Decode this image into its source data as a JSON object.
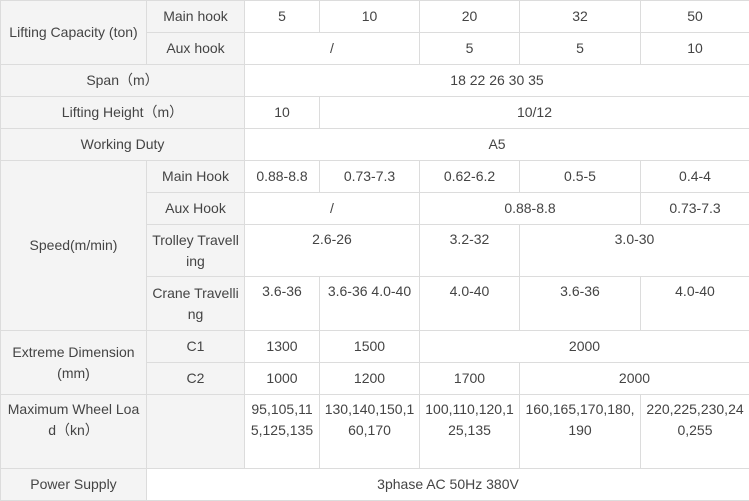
{
  "lifting_capacity": {
    "label": "Lifting Capacity (ton)",
    "main_hook": {
      "label": "Main hook",
      "values": [
        "5",
        "10",
        "20",
        "32",
        "50"
      ]
    },
    "aux_hook": {
      "label": "Aux hook",
      "values": [
        "/",
        "5",
        "5",
        "10"
      ]
    }
  },
  "span": {
    "label": "Span（m）",
    "value": "18 22 26 30 35"
  },
  "lifting_height": {
    "label": "Lifting Height（m）",
    "values": [
      "10",
      "10/12"
    ]
  },
  "working_duty": {
    "label": "Working Duty",
    "value": "A5"
  },
  "speed": {
    "label": "Speed(m/min)",
    "main_hook": {
      "label": "Main Hook",
      "values": [
        "0.88-8.8",
        "0.73-7.3",
        "0.62-6.2",
        "0.5-5",
        "0.4-4"
      ]
    },
    "aux_hook": {
      "label": "Aux Hook",
      "values": [
        "/",
        "0.88-8.8",
        "0.73-7.3"
      ]
    },
    "trolley": {
      "label": "Trolley Travelling",
      "values": [
        "2.6-26",
        "3.2-32",
        "3.0-30"
      ]
    },
    "crane": {
      "label": "Crane Travelling",
      "values": [
        "3.6-36",
        "3.6-36 4.0-40",
        "4.0-40",
        "3.6-36",
        "4.0-40"
      ]
    }
  },
  "extreme_dimension": {
    "label": "Extreme Dimension(mm)",
    "c1": {
      "label": "C1",
      "values": [
        "1300",
        "1500",
        "2000"
      ]
    },
    "c2": {
      "label": "C2",
      "values": [
        "1000",
        "1200",
        "1700",
        "2000"
      ]
    }
  },
  "max_wheel_load": {
    "label": "Maximum Wheel Load（kn）",
    "values": [
      "95,105,115,125,135",
      "130,140,150,160,170",
      "100,110,120,125,135",
      "160,165,170,180,190",
      "220,225,230,240,255"
    ]
  },
  "power_supply": {
    "label": "Power Supply",
    "value": "3phase AC 50Hz 380V"
  }
}
